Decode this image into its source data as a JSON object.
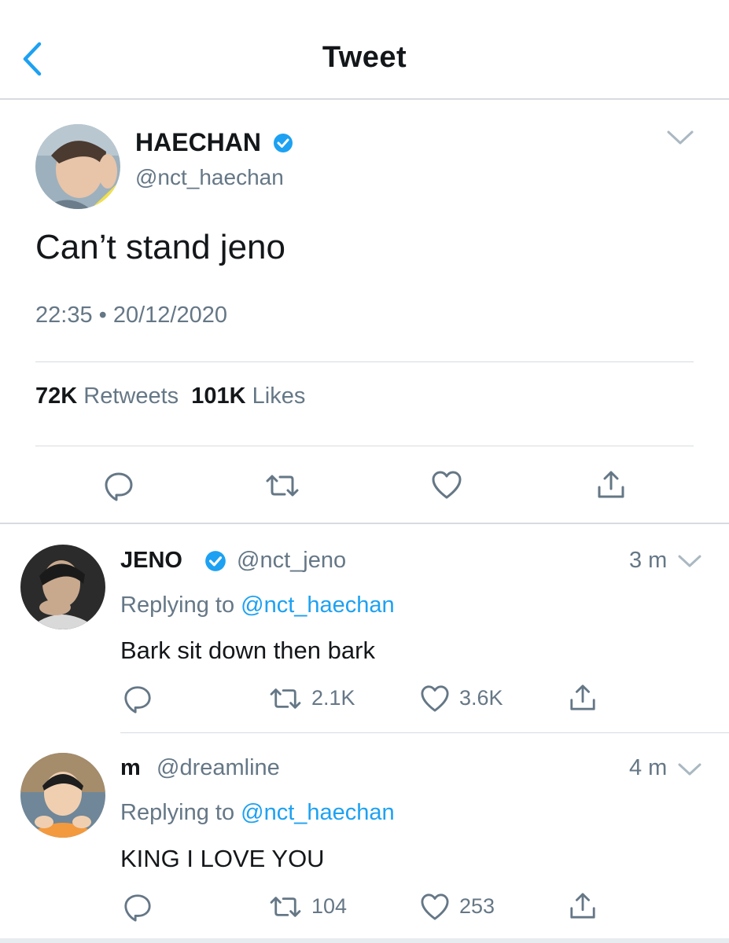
{
  "header": {
    "title": "Tweet",
    "back_icon": "chevron-left-icon",
    "accent": "#1da1f2"
  },
  "main_tweet": {
    "name": "HAECHAN",
    "handle": "@nct_haechan",
    "text": "Can’t stand jeno",
    "time": "22:35",
    "separator": "•",
    "date": "20/12/2020",
    "retweets_count": "72K",
    "retweets_label": "Retweets",
    "likes_count": "101K",
    "likes_label": "Likes"
  },
  "replies": [
    {
      "name": "JENO",
      "verified": true,
      "handle": "@nct_jeno",
      "time": "3 m",
      "replying_prefix": "Replying to",
      "replying_to": "@nct_haechan",
      "text": "Bark sit down then bark",
      "retweets": "2.1K",
      "likes": "3.6K"
    },
    {
      "name": "m",
      "verified": false,
      "handle": "@dreamline",
      "time": "4 m",
      "replying_prefix": "Replying to",
      "replying_to": "@nct_haechan",
      "text": "KING I LOVE YOU",
      "retweets": "104",
      "likes": "253"
    }
  ],
  "colors": {
    "text": "#14171a",
    "muted": "#657786",
    "link": "#1da1f2",
    "divider": "#d7dbdf"
  }
}
